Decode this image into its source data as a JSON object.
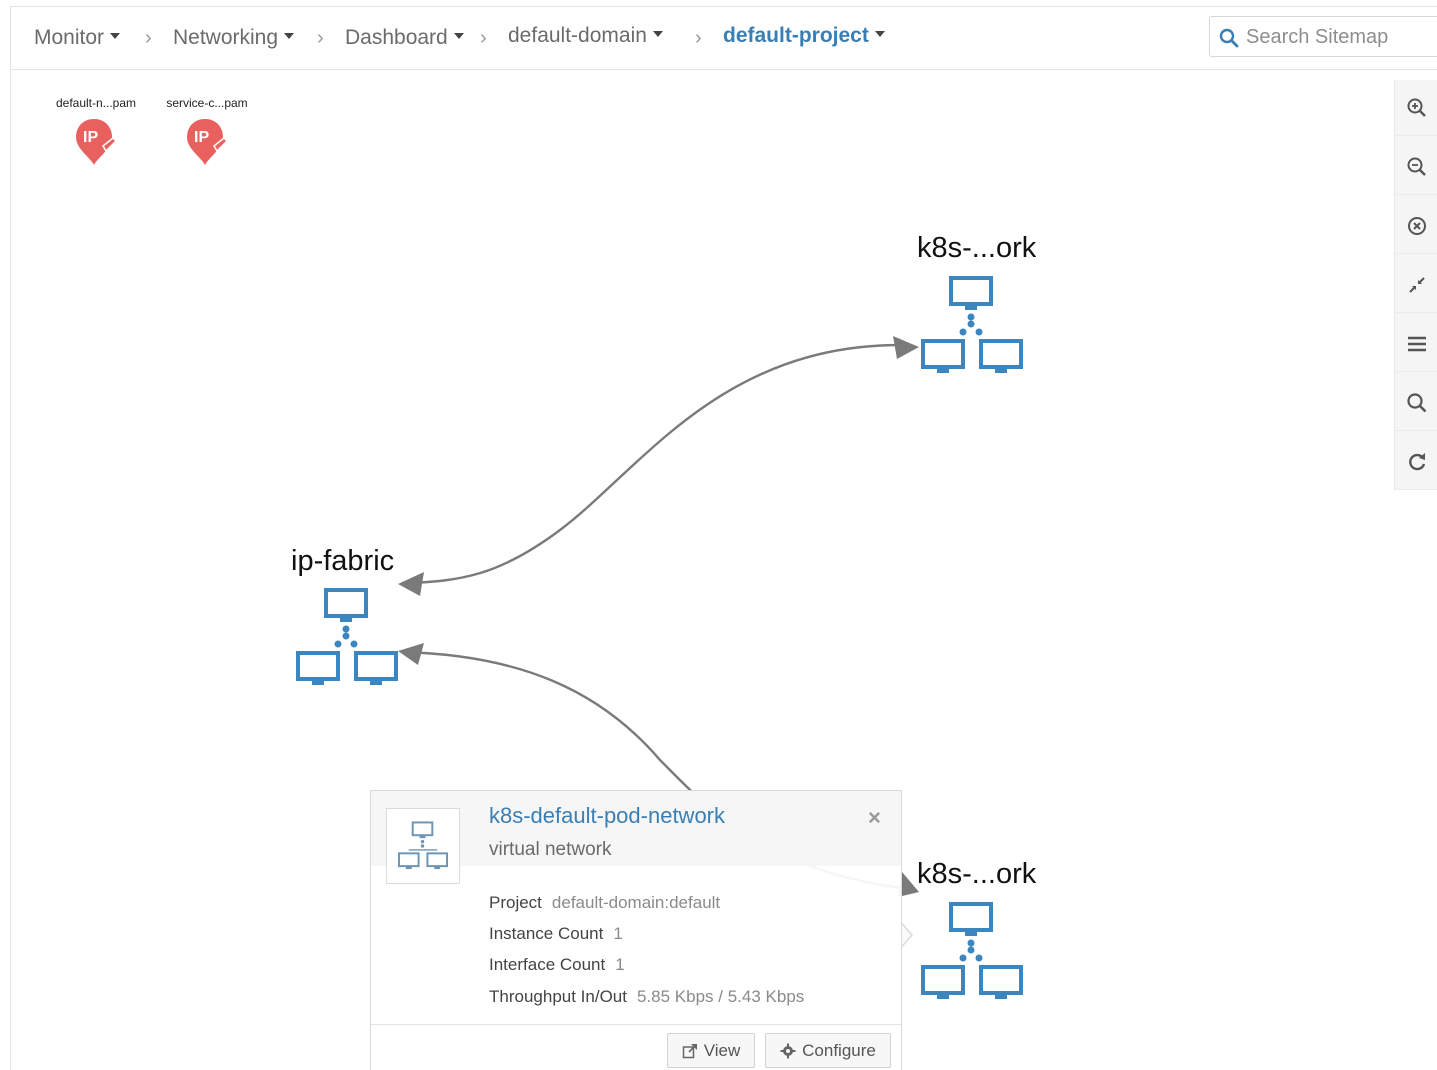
{
  "breadcrumb": {
    "items": [
      {
        "label": "Monitor",
        "dropdown": true
      },
      {
        "label": "Networking",
        "dropdown": true
      },
      {
        "label": "Dashboard",
        "dropdown": true
      },
      {
        "label": "default-domain",
        "dropdown": true
      },
      {
        "label": "default-project",
        "dropdown": true,
        "active": true
      }
    ]
  },
  "search": {
    "placeholder": "Search Sitemap",
    "value": "",
    "icon": "search-icon"
  },
  "toolbar": {
    "tools": [
      "zoom-in-icon",
      "zoom-out-icon",
      "reset-icon",
      "collapse-icon",
      "list-icon",
      "search-icon",
      "refresh-icon"
    ]
  },
  "ipams": [
    {
      "label": "default-n...pam",
      "icon": "ipam-icon"
    },
    {
      "label": "service-c...pam",
      "icon": "ipam-icon"
    }
  ],
  "nodes": {
    "k8s_top": {
      "label": "k8s-...ork",
      "icon": "virtual-network-icon"
    },
    "ip_fabric": {
      "label": "ip-fabric",
      "icon": "virtual-network-icon"
    },
    "k8s_bottom": {
      "label": "k8s-...ork",
      "icon": "virtual-network-icon"
    }
  },
  "popover": {
    "title": "k8s-default-pod-network",
    "subtitle": "virtual network",
    "close": "×",
    "fields": [
      {
        "key": "Project",
        "value": "default-domain:default"
      },
      {
        "key": "Instance Count",
        "value": "1"
      },
      {
        "key": "Interface Count",
        "value": "1"
      },
      {
        "key": "Throughput In/Out",
        "value": "5.85 Kbps / 5.43 Kbps"
      }
    ],
    "buttons": {
      "view": "View",
      "configure": "Configure"
    }
  },
  "colors": {
    "accent": "#3a7fb4",
    "node_blue": "#3c86bf",
    "ipam_red": "#e8615f",
    "edge": "#7a7a7a"
  }
}
